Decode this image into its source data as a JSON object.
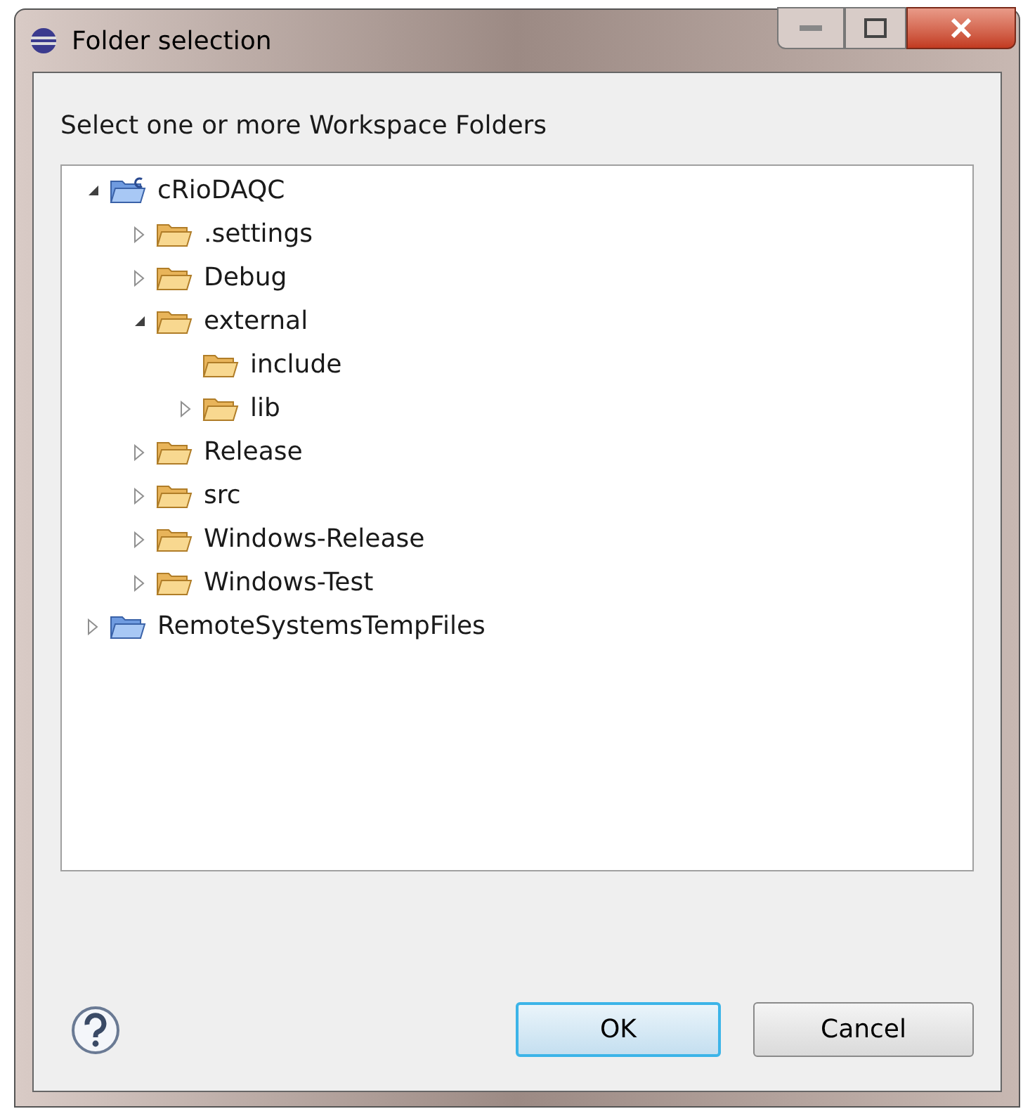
{
  "window": {
    "title": "Folder selection"
  },
  "prompt": "Select one or more Workspace Folders",
  "tree": [
    {
      "label": "cRioDAQC",
      "kind": "project",
      "leaf": false,
      "expanded": true,
      "children": [
        {
          "label": ".settings",
          "kind": "folder",
          "leaf": false,
          "expanded": false
        },
        {
          "label": "Debug",
          "kind": "folder",
          "leaf": false,
          "expanded": false
        },
        {
          "label": "external",
          "kind": "folder",
          "leaf": false,
          "expanded": true,
          "children": [
            {
              "label": "include",
              "kind": "folder",
              "leaf": true,
              "expanded": false
            },
            {
              "label": "lib",
              "kind": "folder",
              "leaf": false,
              "expanded": false
            }
          ]
        },
        {
          "label": "Release",
          "kind": "folder",
          "leaf": false,
          "expanded": false
        },
        {
          "label": "src",
          "kind": "folder",
          "leaf": false,
          "expanded": false
        },
        {
          "label": "Windows-Release",
          "kind": "folder",
          "leaf": false,
          "expanded": false
        },
        {
          "label": "Windows-Test",
          "kind": "folder",
          "leaf": false,
          "expanded": false
        }
      ]
    },
    {
      "label": "RemoteSystemsTempFiles",
      "kind": "project-folder",
      "leaf": false,
      "expanded": false
    }
  ],
  "buttons": [
    {
      "label": "OK",
      "kind": "default"
    },
    {
      "label": "Cancel",
      "kind": "normal"
    }
  ]
}
